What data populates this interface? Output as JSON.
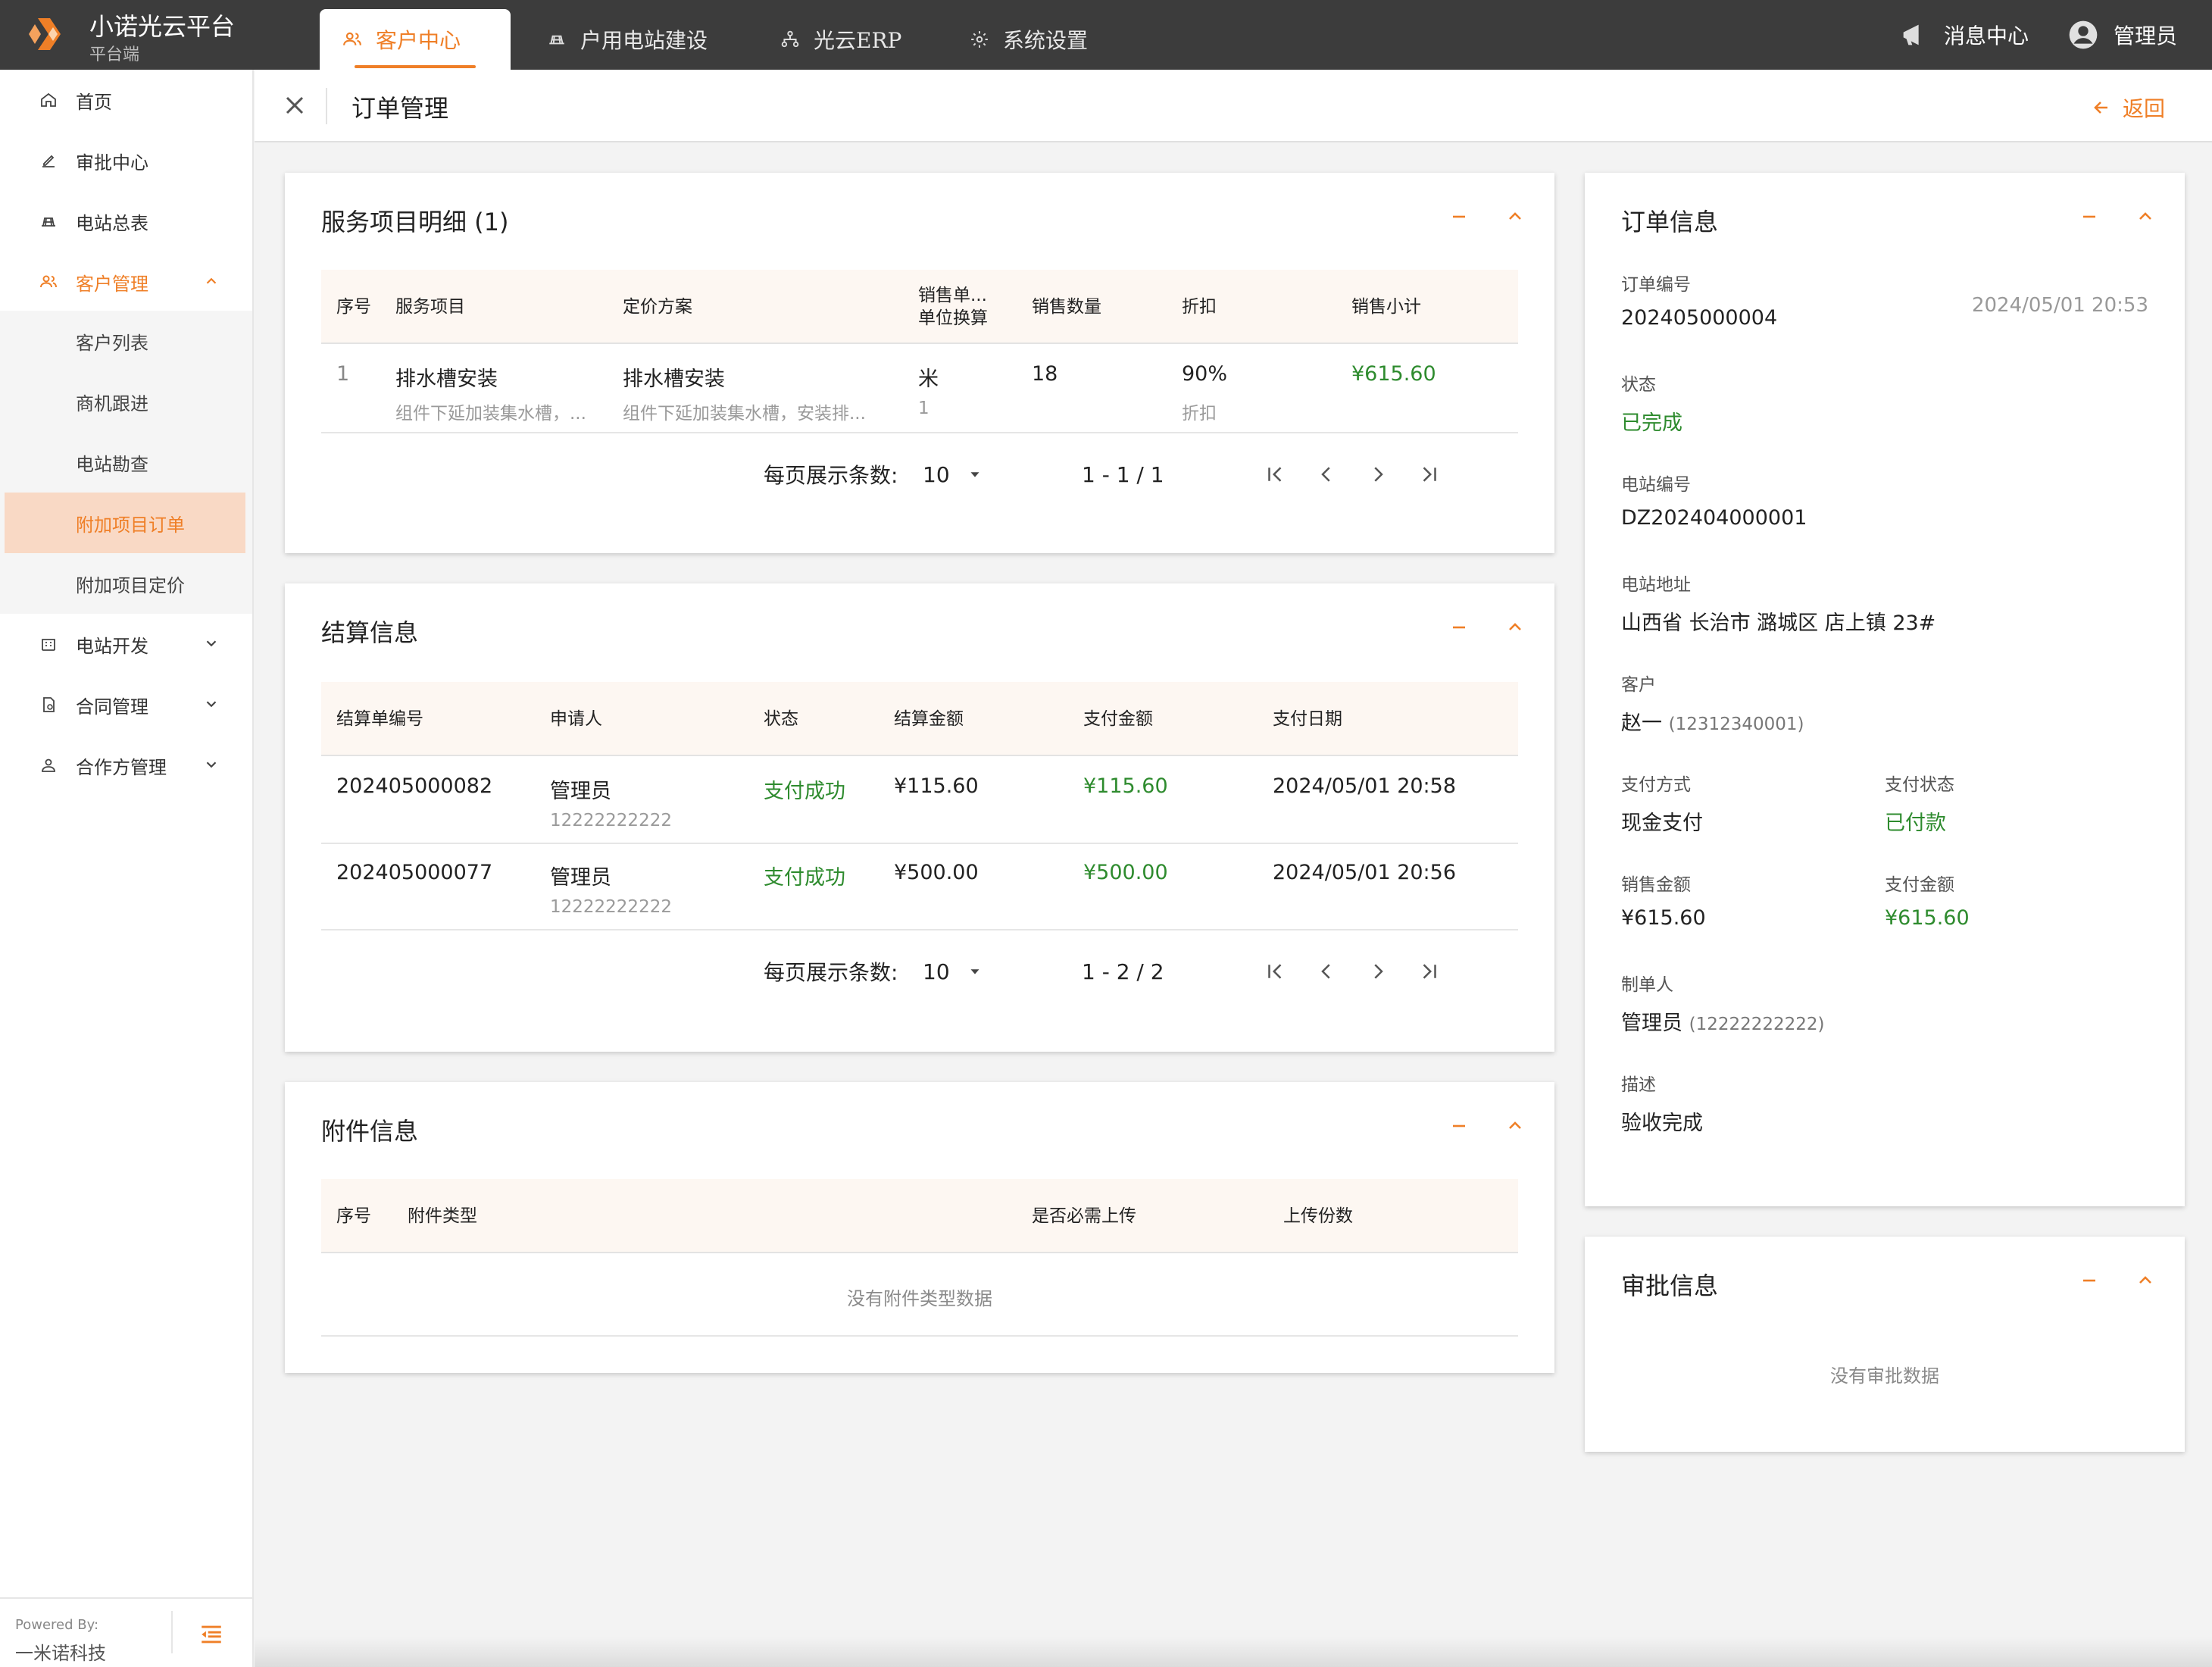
{
  "brand": {
    "name": "小诺光云平台",
    "sub": "平台端"
  },
  "topnav": {
    "tabs": [
      {
        "label": "客户中心",
        "icon": "users-icon",
        "active": true
      },
      {
        "label": "户用电站建设",
        "icon": "station-icon"
      },
      {
        "label": "光云ERP",
        "icon": "hierarchy-icon"
      },
      {
        "label": "系统设置",
        "icon": "gear-icon"
      }
    ],
    "messages": "消息中心",
    "user": "管理员"
  },
  "sidebar": {
    "items": [
      {
        "label": "首页",
        "icon": "home-icon"
      },
      {
        "label": "审批中心",
        "icon": "pen-icon"
      },
      {
        "label": "电站总表",
        "icon": "station-icon"
      },
      {
        "label": "客户管理",
        "icon": "users-icon",
        "open": true
      },
      {
        "label": "电站开发",
        "icon": "building-icon"
      },
      {
        "label": "合同管理",
        "icon": "contract-icon"
      },
      {
        "label": "合作方管理",
        "icon": "partner-icon"
      }
    ],
    "sub_items": [
      {
        "label": "客户列表"
      },
      {
        "label": "商机跟进"
      },
      {
        "label": "电站勘查"
      },
      {
        "label": "附加项目订单",
        "active": true
      },
      {
        "label": "附加项目定价"
      }
    ],
    "footer": {
      "powered": "Powered By:",
      "company": "一米诺科技"
    }
  },
  "page": {
    "title": "订单管理",
    "back": "返回"
  },
  "service_items": {
    "title": "服务项目明细 (1)",
    "headers": {
      "no": "序号",
      "item": "服务项目",
      "plan": "定价方案",
      "unit1": "销售单...",
      "unit2": "单位换算",
      "qty": "销售数量",
      "discount": "折扣",
      "subtotal": "销售小计"
    },
    "rows": [
      {
        "no": "1",
        "item": "排水槽安装",
        "item_desc": "组件下延加装集水槽，...",
        "plan": "排水槽安装",
        "plan_desc": "组件下延加装集水槽，安装排...",
        "unit": "米",
        "conv": "1",
        "qty": "18",
        "discount": "90%",
        "discount_sub": "折扣",
        "subtotal": "¥615.60"
      }
    ],
    "pager": {
      "label": "每页展示条数:",
      "size": "10",
      "range": "1 - 1 / 1"
    }
  },
  "settlement": {
    "title": "结算信息",
    "headers": {
      "no": "结算单编号",
      "applicant": "申请人",
      "status": "状态",
      "amount": "结算金额",
      "paid": "支付金额",
      "date": "支付日期"
    },
    "rows": [
      {
        "no": "202405000082",
        "applicant": "管理员",
        "phone": "12222222222",
        "status": "支付成功",
        "amount": "¥115.60",
        "paid": "¥115.60",
        "date": "2024/05/01 20:58"
      },
      {
        "no": "202405000077",
        "applicant": "管理员",
        "phone": "12222222222",
        "status": "支付成功",
        "amount": "¥500.00",
        "paid": "¥500.00",
        "date": "2024/05/01 20:56"
      }
    ],
    "pager": {
      "label": "每页展示条数:",
      "size": "10",
      "range": "1 - 2 / 2"
    }
  },
  "attachments": {
    "title": "附件信息",
    "headers": {
      "no": "序号",
      "type": "附件类型",
      "required": "是否必需上传",
      "count": "上传份数"
    },
    "empty": "没有附件类型数据"
  },
  "order_info": {
    "title": "订单信息",
    "order_no_label": "订单编号",
    "order_no": "202405000004",
    "created": "2024/05/01 20:53",
    "status_label": "状态",
    "status": "已完成",
    "station_no_label": "电站编号",
    "station_no": "DZ202404000001",
    "address_label": "电站地址",
    "address": "山西省 长治市 潞城区 店上镇 23#",
    "customer_label": "客户",
    "customer": "赵一",
    "customer_phone": "(12312340001)",
    "pay_method_label": "支付方式",
    "pay_method": "现金支付",
    "pay_status_label": "支付状态",
    "pay_status": "已付款",
    "sales_amount_label": "销售金额",
    "sales_amount": "¥615.60",
    "paid_amount_label": "支付金额",
    "paid_amount": "¥615.60",
    "creator_label": "制单人",
    "creator": "管理员",
    "creator_phone": "(12222222222)",
    "desc_label": "描述",
    "desc": "验收完成"
  },
  "approval": {
    "title": "审批信息",
    "empty": "没有审批数据"
  },
  "colors": {
    "accent": "#ef7f27",
    "success": "#2e8b2e",
    "topbar": "#3c3c3c"
  }
}
